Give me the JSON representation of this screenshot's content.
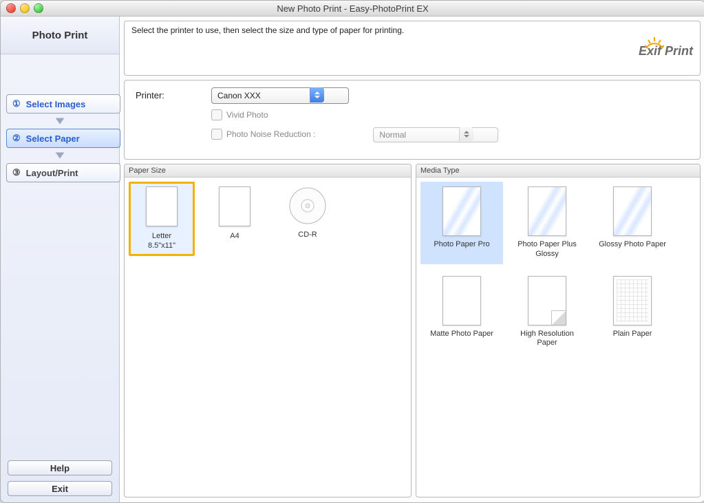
{
  "window": {
    "title": "New Photo Print - Easy-PhotoPrint EX"
  },
  "sidebar": {
    "brand": "Photo Print",
    "steps": [
      {
        "num": "①",
        "label": "Select Images"
      },
      {
        "num": "②",
        "label": "Select Paper"
      },
      {
        "num": "③",
        "label": "Layout/Print"
      }
    ],
    "help": "Help",
    "exit": "Exit"
  },
  "instruction": "Select the printer to use, then select the size and type of paper for printing.",
  "exif_label": "Exif Print",
  "printer_panel": {
    "printer_label": "Printer:",
    "printer_value": "Canon XXX",
    "vivid_label": "Vivid Photo",
    "noise_label": "Photo Noise Reduction :",
    "noise_value": "Normal"
  },
  "paper_size": {
    "header": "Paper Size",
    "items": [
      {
        "label": "Letter\n8.5\"x11\"",
        "kind": "sheet",
        "selected": true
      },
      {
        "label": "A4",
        "kind": "sheet",
        "selected": false
      },
      {
        "label": "CD-R",
        "kind": "cd",
        "selected": false
      }
    ]
  },
  "media_type": {
    "header": "Media Type",
    "items": [
      {
        "label": "Photo Paper Pro",
        "style": "glossy",
        "selected": true
      },
      {
        "label": "Photo Paper Plus Glossy",
        "style": "glossy",
        "selected": false
      },
      {
        "label": "Glossy Photo Paper",
        "style": "glossy",
        "selected": false
      },
      {
        "label": "Matte Photo Paper",
        "style": "matte",
        "selected": false
      },
      {
        "label": "High Resolution Paper",
        "style": "fold",
        "selected": false
      },
      {
        "label": "Plain Paper",
        "style": "plain",
        "selected": false
      }
    ]
  }
}
